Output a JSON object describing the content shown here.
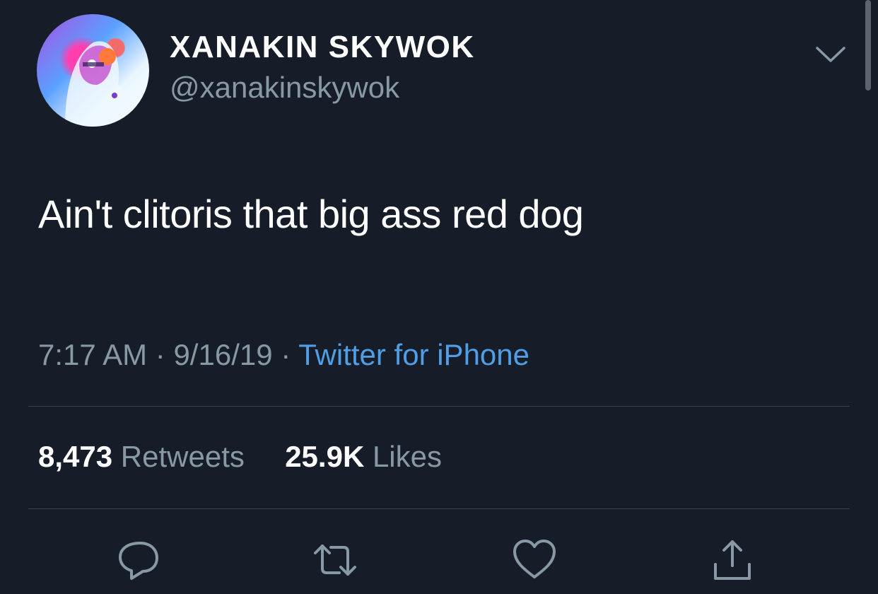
{
  "user": {
    "display_name": "XANAKIN SKYWOK",
    "handle": "@xanakinskywok"
  },
  "tweet": {
    "text": "Ain't clitoris that big ass red dog",
    "time": "7:17 AM",
    "date": "9/16/19",
    "separator": "·",
    "source": "Twitter for iPhone"
  },
  "stats": {
    "retweets_count": "8,473",
    "retweets_label": "Retweets",
    "likes_count": "25.9K",
    "likes_label": "Likes"
  },
  "icons": {
    "more": "chevron-down-icon",
    "reply": "reply-icon",
    "retweet": "retweet-icon",
    "like": "heart-icon",
    "share": "share-icon"
  },
  "colors": {
    "background": "#161d29",
    "secondary_text": "#8899a6",
    "link": "#4f9ee6",
    "divider": "#38444d"
  }
}
